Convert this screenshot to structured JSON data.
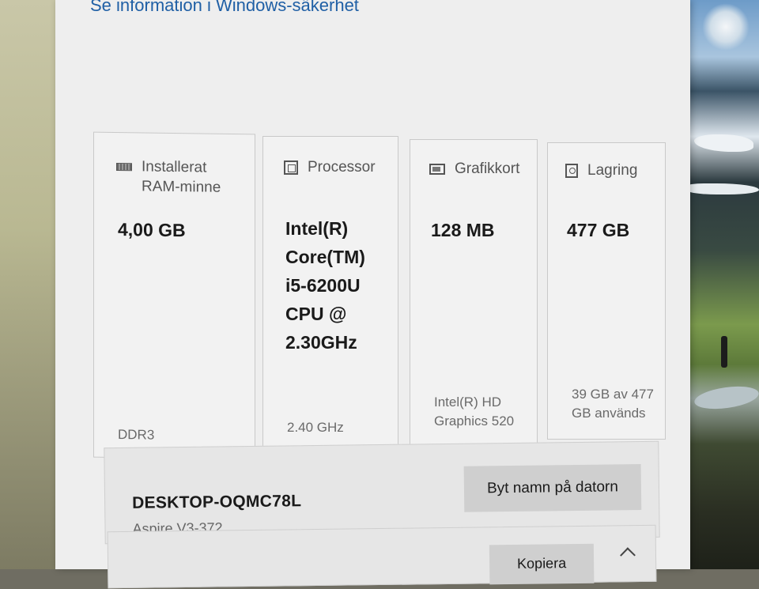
{
  "security_link": "Se information i Windows-säkerhet",
  "specs": [
    {
      "label_line1": "Installerat",
      "label_line2": "RAM-minne",
      "icon": "ram-icon",
      "value": "4,00 GB",
      "sub": "DDR3"
    },
    {
      "label_line1": "Processor",
      "icon": "cpu-icon",
      "value_lines": [
        "Intel(R)",
        "Core(TM)",
        "i5-6200U",
        "CPU @",
        "2.30GHz"
      ],
      "sub": "2.40 GHz"
    },
    {
      "label_line1": "Grafikkort",
      "icon": "gpu-icon",
      "value": "128 MB",
      "sub_lines": [
        "Intel(R) HD",
        "Graphics 520"
      ]
    },
    {
      "label_line1": "Lagring",
      "icon": "storage-icon",
      "value": "477 GB",
      "sub_lines": [
        "39 GB av 477",
        "GB används"
      ]
    }
  ],
  "device": {
    "name": "DESKTOP-OQMC78L",
    "model": "Aspire V3-372",
    "rename_button": "Byt namn på datorn"
  },
  "copy_button": "Kopiera"
}
